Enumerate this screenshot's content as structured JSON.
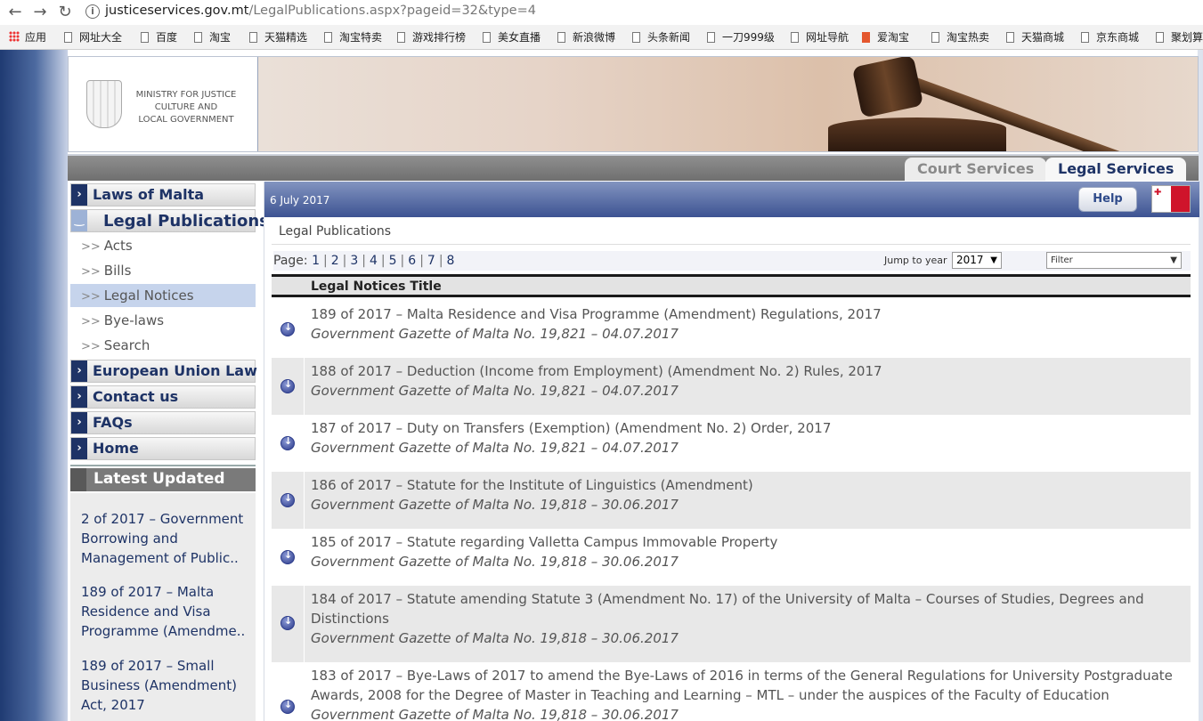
{
  "browser": {
    "url_host": "justiceservices.gov.mt",
    "url_path": "/LegalPublications.aspx?pageid=32&type=4",
    "bookmarks": [
      "应用",
      "网址大全",
      "百度",
      "淘宝",
      "天猫精选",
      "淘宝特卖",
      "游戏排行榜",
      "美女直播",
      "新浪微博",
      "头条新闻",
      "一刀999级",
      "网址导航",
      "爱淘宝",
      "淘宝热卖",
      "天猫商城",
      "京东商城",
      "聚划算"
    ]
  },
  "header": {
    "ministry_line1": "MINISTRY FOR JUSTICE",
    "ministry_line2": "CULTURE AND",
    "ministry_line3": "LOCAL GOVERNMENT",
    "tab_court": "Court Services",
    "tab_legal": "Legal Services"
  },
  "sidebar": {
    "laws": "Laws of Malta",
    "legal_publications": "Legal Publications",
    "sub": [
      "Acts",
      "Bills",
      "Legal Notices",
      "Bye-laws",
      "Search"
    ],
    "eu_law": "European Union Law",
    "contact": "Contact us",
    "faqs": "FAQs",
    "home": "Home",
    "latest_title": "Latest Updated",
    "latest": [
      "2 of 2017 – Government Borrowing and Management of Public..",
      "189 of 2017 – Malta Residence and Visa Programme (Amendme..",
      "189 of 2017 – Small Business (Amendment) Act, 2017"
    ]
  },
  "main": {
    "date": "6 July 2017",
    "help": "Help",
    "breadcrumb": "Legal Publications",
    "page_label": "Page:",
    "pages": [
      "1",
      "2",
      "3",
      "4",
      "5",
      "6",
      "7",
      "8"
    ],
    "jump_label": "Jump to year",
    "year": "2017",
    "filter": "Filter",
    "col_header": "Legal Notices  Title",
    "rows": [
      {
        "title": "189 of 2017 – Malta Residence and Visa Programme (Amendment) Regulations, 2017",
        "gazette": "Government Gazette of Malta No. 19,821 – 04.07.2017"
      },
      {
        "title": "188 of 2017 – Deduction (Income from Employment) (Amendment No. 2) Rules, 2017",
        "gazette": "Government Gazette of Malta No. 19,821 – 04.07.2017"
      },
      {
        "title": "187 of 2017 – Duty on Transfers (Exemption) (Amendment No. 2) Order, 2017",
        "gazette": "Government Gazette of Malta No. 19,821 – 04.07.2017"
      },
      {
        "title": "186 of 2017 – Statute for the Institute of Linguistics (Amendment)",
        "gazette": "Government Gazette of Malta No. 19,818 – 30.06.2017"
      },
      {
        "title": "185 of 2017 – Statute regarding Valletta Campus Immovable Property",
        "gazette": "Government Gazette of Malta No. 19,818 – 30.06.2017"
      },
      {
        "title": "184 of 2017 – Statute amending Statute 3 (Amendment No. 17) of the University of Malta – Courses of Studies, Degrees and Distinctions",
        "gazette": "Government Gazette of Malta No. 19,818 – 30.06.2017"
      },
      {
        "title": "183 of 2017 – Bye-Laws of 2017 to amend the Bye-Laws of 2016 in terms of the General Regulations for University Postgraduate Awards, 2008 for the Degree of Master in Teaching and Learning – MTL – under the auspices of the Faculty of Education",
        "gazette": "Government Gazette of Malta No. 19,818 – 30.06.2017"
      }
    ]
  }
}
